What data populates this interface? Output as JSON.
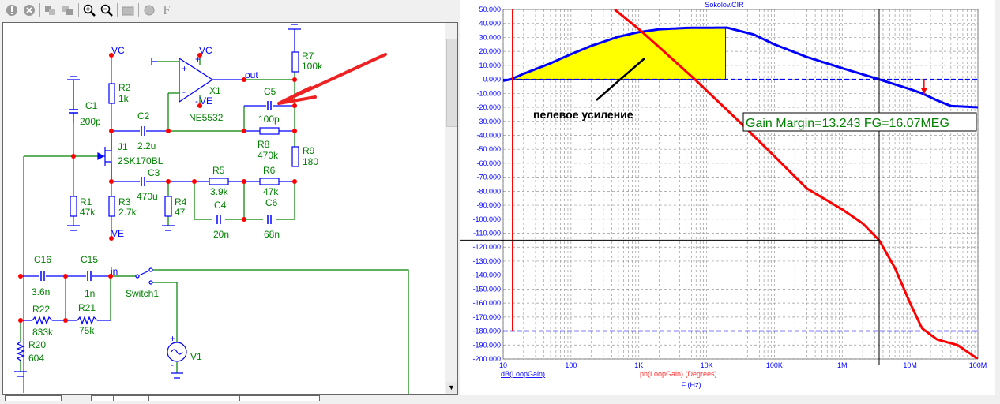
{
  "toolbar": {
    "icons": [
      "warning-icon",
      "stop-icon",
      "copy-icon",
      "paste-icon",
      "zoom-in-icon",
      "zoom-out-icon",
      "folder-icon",
      "globe-icon",
      "font-icon"
    ],
    "font_glyph": "F"
  },
  "schematic": {
    "nets": {
      "vc1": "VC",
      "vc2": "VC",
      "ve1": "VE",
      "ve2": "VE",
      "out": "out",
      "in": "in"
    },
    "parts": {
      "C1": {
        "name": "C1",
        "value": "200p"
      },
      "R1": {
        "name": "R1",
        "value": "47k"
      },
      "R2": {
        "name": "R2",
        "value": "1k"
      },
      "R3": {
        "name": "R3",
        "value": "2.7k"
      },
      "R4": {
        "name": "R4",
        "value": "47"
      },
      "C2": {
        "name": "C2",
        "value": "2.2u"
      },
      "C3": {
        "name": "C3",
        "value": "470u"
      },
      "J1": {
        "name": "J1",
        "value": "2SK170BL"
      },
      "X1": {
        "name": "X1",
        "value": "NE5532"
      },
      "R7": {
        "name": "R7",
        "value": "100k"
      },
      "C5": {
        "name": "C5",
        "value": "100p"
      },
      "R8": {
        "name": "R8",
        "value": "470k"
      },
      "R9": {
        "name": "R9",
        "value": "180"
      },
      "R5": {
        "name": "R5",
        "value": "3.9k"
      },
      "R6": {
        "name": "R6",
        "value": "47k"
      },
      "C4": {
        "name": "C4",
        "value": "20n"
      },
      "C6": {
        "name": "C6",
        "value": "68n"
      },
      "C16": {
        "name": "C16",
        "value": "3.6n"
      },
      "C15": {
        "name": "C15",
        "value": "1n"
      },
      "R22": {
        "name": "R22",
        "value": "833k"
      },
      "R21": {
        "name": "R21",
        "value": "75k"
      },
      "R20": {
        "name": "R20",
        "value": "604"
      },
      "Switch1": {
        "name": "Switch1"
      },
      "V1": {
        "name": "V1"
      }
    },
    "opamp_plus": "+",
    "opamp_minus": "-",
    "v_plus": "+",
    "v_minus": "-"
  },
  "chart_data": {
    "type": "line",
    "title": "Sokolov.CIR",
    "xlabel": "F (Hz)",
    "x_scale": "log",
    "xlim": [
      10,
      100000000
    ],
    "ylim": [
      -200,
      50
    ],
    "x_ticks": [
      {
        "v": 10,
        "label": "10"
      },
      {
        "v": 100,
        "label": "100"
      },
      {
        "v": 1000,
        "label": "1K"
      },
      {
        "v": 10000,
        "label": "10K"
      },
      {
        "v": 100000,
        "label": "100K"
      },
      {
        "v": 1000000,
        "label": "1M"
      },
      {
        "v": 10000000,
        "label": "10M"
      },
      {
        "v": 100000000,
        "label": "100M"
      }
    ],
    "y_ticks": [
      "50.000",
      "40.000",
      "30.000",
      "20.000",
      "10.000",
      "0.000",
      "-10.000",
      "-20.000",
      "-30.000",
      "-40.000",
      "-50.000",
      "-60.000",
      "-70.000",
      "-80.000",
      "-90.000",
      "-100.000",
      "-110.000",
      "-120.000",
      "-130.000",
      "-140.000",
      "-150.000",
      "-160.000",
      "-170.000",
      "-180.000",
      "-190.000",
      "-200.000"
    ],
    "grid": true,
    "series": [
      {
        "name": "dB(LoopGain)",
        "color": "#0000ff",
        "points": [
          [
            10,
            -1
          ],
          [
            13,
            0
          ],
          [
            20,
            4
          ],
          [
            50,
            11.5
          ],
          [
            100,
            18
          ],
          [
            200,
            24
          ],
          [
            500,
            30.5
          ],
          [
            1000,
            33.8
          ],
          [
            2000,
            35.8
          ],
          [
            5000,
            36.8
          ],
          [
            20000,
            37
          ],
          [
            50000,
            32
          ],
          [
            100000,
            25
          ],
          [
            300000,
            16
          ],
          [
            1000000,
            8
          ],
          [
            3500000,
            0
          ],
          [
            10000000,
            -7
          ],
          [
            15000000,
            -10
          ],
          [
            25000000,
            -15
          ],
          [
            40000000,
            -19
          ],
          [
            100000000,
            -20
          ]
        ]
      },
      {
        "name": "ph(LoopGain) (Degrees)",
        "color": "#ff0000",
        "points": [
          [
            440,
            50
          ],
          [
            1000,
            36
          ],
          [
            2000,
            23
          ],
          [
            6700,
            0
          ],
          [
            10000,
            -8
          ],
          [
            30000,
            -30
          ],
          [
            100000,
            -55
          ],
          [
            300000,
            -78
          ],
          [
            1000000,
            -93
          ],
          [
            2000000,
            -103
          ],
          [
            3500000,
            -115
          ],
          [
            6000000,
            -135
          ],
          [
            10000000,
            -160
          ],
          [
            15000000,
            -178
          ],
          [
            25000000,
            -186
          ],
          [
            50000000,
            -190
          ],
          [
            100000000,
            -200
          ]
        ]
      }
    ],
    "reference_lines": [
      {
        "y": 0,
        "style": "dashed",
        "color": "#0000ff"
      },
      {
        "y": -180,
        "style": "dashed",
        "color": "#0000ff"
      }
    ],
    "cursor": {
      "x": 3500000,
      "y": -115
    },
    "red_marker_x": 13.8,
    "gain_margin_arrow_x": 16070000,
    "shaded_region": {
      "from": 13,
      "to": 19000,
      "color": "#ffff00"
    },
    "annotation": "пелевое усиление",
    "gain_margin_label": "Gain Margin=13.243 FG=16.07MEG",
    "legend": {
      "gain": "dB(LoopGain)",
      "phase": "ph(LoopGain) (Degrees)"
    }
  }
}
